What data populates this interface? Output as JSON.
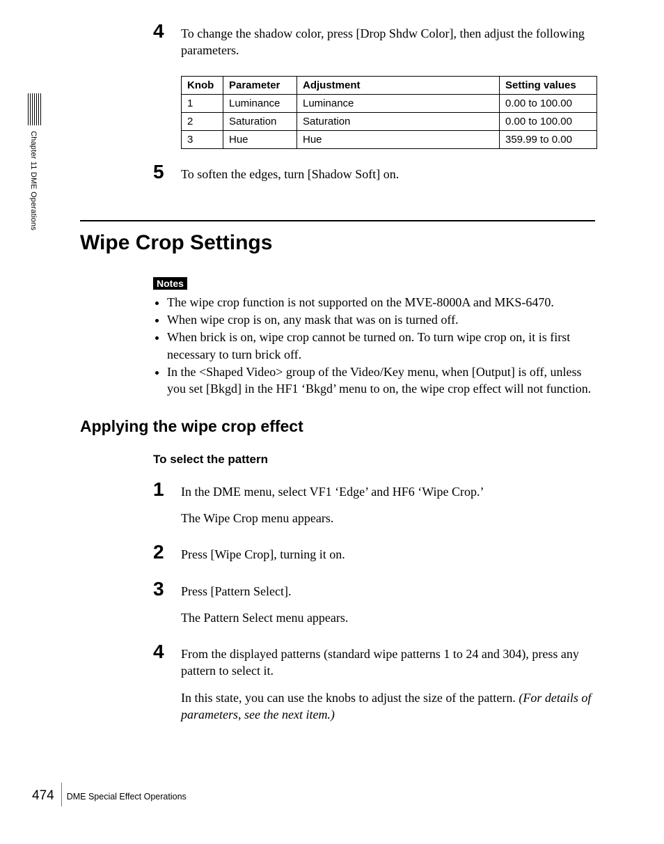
{
  "side": {
    "label": "Chapter 11  DME Operations"
  },
  "step4": {
    "num": "4",
    "text": "To change the shadow color, press [Drop Shdw Color], then adjust the following parameters."
  },
  "table": {
    "headers": {
      "c1": "Knob",
      "c2": "Parameter",
      "c3": "Adjustment",
      "c4": "Setting values"
    },
    "rows": [
      {
        "c1": "1",
        "c2": "Luminance",
        "c3": "Luminance",
        "c4": "0.00 to 100.00"
      },
      {
        "c1": "2",
        "c2": "Saturation",
        "c3": "Saturation",
        "c4": "0.00 to 100.00"
      },
      {
        "c1": "3",
        "c2": "Hue",
        "c3": "Hue",
        "c4": "359.99 to 0.00"
      }
    ]
  },
  "step5": {
    "num": "5",
    "text": "To soften the edges, turn [Shadow Soft] on."
  },
  "h1": "Wipe Crop Settings",
  "notes_label": "Notes",
  "notes": [
    "The wipe crop function is not supported on the MVE-8000A and MKS-6470.",
    "When wipe crop is on, any mask that was on is turned off.",
    "When brick is on, wipe crop cannot be turned on. To turn wipe crop on, it is first necessary to turn brick off.",
    "In the <Shaped Video> group of the Video/Key menu, when [Output] is off, unless you set [Bkgd] in the HF1 ‘Bkgd’ menu to on, the wipe crop effect will not function."
  ],
  "h2": "Applying the wipe crop effect",
  "h3": "To select the pattern",
  "steps": {
    "s1": {
      "num": "1",
      "p1": "In the DME menu, select VF1 ‘Edge’ and HF6 ‘Wipe Crop.’",
      "p2": "The Wipe Crop menu appears."
    },
    "s2": {
      "num": "2",
      "p1": "Press [Wipe Crop], turning it on."
    },
    "s3": {
      "num": "3",
      "p1": "Press [Pattern Select].",
      "p2": "The Pattern Select menu appears."
    },
    "s4": {
      "num": "4",
      "p1": "From the displayed patterns (standard wipe patterns 1 to 24 and 304), press any pattern to select it.",
      "p2a": "In this state, you can use the knobs to adjust the size of the pattern. ",
      "p2b": "(For details of parameters, see the next item.)"
    }
  },
  "footer": {
    "page": "474",
    "title": "DME Special Effect Operations"
  }
}
